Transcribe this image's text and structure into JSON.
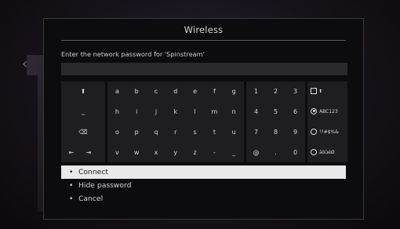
{
  "dialog": {
    "title": "Wireless",
    "prompt": "Enter the network password for 'Spinstream'",
    "password_value": ""
  },
  "keyboard": {
    "special_keys": [
      {
        "name": "shift-key",
        "glyph": "⬆"
      },
      {
        "name": "space-key",
        "glyph": "⎵"
      },
      {
        "name": "backspace-key",
        "glyph": "⌫"
      },
      {
        "name": "cursor-left-key",
        "glyph": "⇤"
      },
      {
        "name": "cursor-right-key",
        "glyph": "⇥"
      }
    ],
    "letters": [
      [
        "a",
        "b",
        "c",
        "d",
        "e",
        "f",
        "g"
      ],
      [
        "h",
        "i",
        "j",
        "k",
        "l",
        "m",
        "n"
      ],
      [
        "o",
        "p",
        "q",
        "r",
        "s",
        "t",
        "u"
      ],
      [
        "v",
        "w",
        "x",
        "y",
        "z",
        "-",
        "_"
      ]
    ],
    "digits": [
      [
        "1",
        "2",
        "3"
      ],
      [
        "4",
        "5",
        "6"
      ],
      [
        "7",
        "8",
        "9"
      ],
      [
        "@",
        ".",
        "0"
      ]
    ],
    "modes": {
      "caps_label": "⬆",
      "options": [
        {
          "label": "ABC123",
          "selected": true
        },
        {
          "label": "!?#$%&",
          "selected": false
        },
        {
          "label": "äöüéØ",
          "selected": false
        }
      ]
    }
  },
  "options": [
    {
      "label": "Connect",
      "selected": true
    },
    {
      "label": "Hide password",
      "selected": false
    },
    {
      "label": "Cancel",
      "selected": false
    }
  ],
  "bullet": "•"
}
